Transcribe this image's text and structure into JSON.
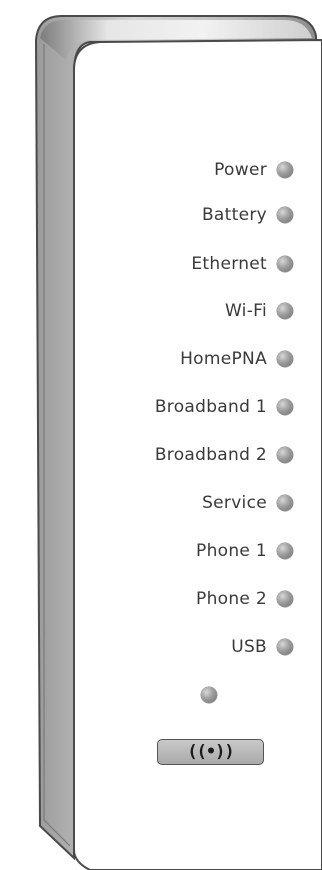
{
  "indicators": [
    {
      "label": "Power",
      "icon": "led-indicator"
    },
    {
      "label": "Battery",
      "icon": "led-indicator"
    },
    {
      "label": "Ethernet",
      "icon": "led-indicator"
    },
    {
      "label": "Wi-Fi",
      "icon": "led-indicator"
    },
    {
      "label": "HomePNA",
      "icon": "led-indicator"
    },
    {
      "label": "Broadband 1",
      "icon": "led-indicator"
    },
    {
      "label": "Broadband 2",
      "icon": "led-indicator"
    },
    {
      "label": "Service",
      "icon": "led-indicator"
    },
    {
      "label": "Phone 1",
      "icon": "led-indicator"
    },
    {
      "label": "Phone 2",
      "icon": "led-indicator"
    },
    {
      "label": "USB",
      "icon": "led-indicator"
    }
  ],
  "wps_button": {
    "glyph": "((•))",
    "icon": "wireless-signal-icon"
  },
  "colors": {
    "device_body": "#ffffff",
    "device_outline": "#4a4a4a",
    "side_panel": "#c4c4c4",
    "led": "#8f8f8f"
  }
}
